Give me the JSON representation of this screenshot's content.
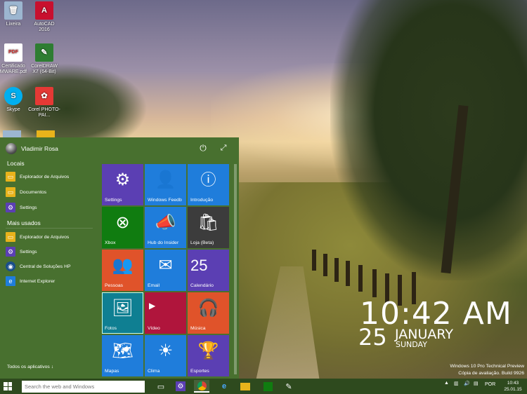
{
  "desktop": {
    "icons": [
      {
        "label": "Lixeira",
        "icon": "recycle-bin-icon",
        "color": "#9cb6d0"
      },
      {
        "label": "AutoCAD 2016",
        "icon": "autocad-icon",
        "color": "#c8102e"
      },
      {
        "label": "Certificado MWARE.pdf",
        "icon": "pdf-icon",
        "color": "#d32f2f"
      },
      {
        "label": "CorelDRAW X7 (64-Bit)",
        "icon": "coreldraw-icon",
        "color": "#2e7d32"
      },
      {
        "label": "Skype",
        "icon": "skype-icon",
        "color": "#00aff0"
      },
      {
        "label": "Corel PHOTO-PAI...",
        "icon": "corel-photopaint-icon",
        "color": "#e53935"
      }
    ]
  },
  "start_menu": {
    "user_name": "Vladimir Rosa",
    "sections": {
      "locais_title": "Locais",
      "mais_usados_title": "Mais usados"
    },
    "locais": [
      {
        "label": "Explorador de Arquivos",
        "icon": "file-explorer-icon"
      },
      {
        "label": "Documentos",
        "icon": "documents-icon"
      },
      {
        "label": "Settings",
        "icon": "settings-icon"
      }
    ],
    "mais_usados": [
      {
        "label": "Explorador de Arquivos",
        "icon": "file-explorer-icon"
      },
      {
        "label": "Settings",
        "icon": "settings-icon"
      },
      {
        "label": "Central de Soluções HP",
        "icon": "hp-icon"
      },
      {
        "label": "Internet Explorer",
        "icon": "internet-explorer-icon"
      }
    ],
    "all_apps_label": "Todos os aplicativos ↓",
    "tiles": [
      {
        "label": "Settings",
        "icon": "gear-icon",
        "color": "#5b3fb3"
      },
      {
        "label": "Windows Feedb",
        "icon": "feedback-icon",
        "color": "#1f7ddb"
      },
      {
        "label": "Introdução",
        "icon": "help-icon",
        "color": "#1f7ddb"
      },
      {
        "label": "Xbox",
        "icon": "xbox-icon",
        "color": "#107c10"
      },
      {
        "label": "Hub do Insider",
        "icon": "megaphone-icon",
        "color": "#1f7ddb"
      },
      {
        "label": "Loja (Beta)",
        "icon": "store-icon",
        "color": "#3c3c3c"
      },
      {
        "label": "Pessoas",
        "icon": "people-icon",
        "color": "#e0532a"
      },
      {
        "label": "Email",
        "icon": "mail-icon",
        "color": "#1f7ddb"
      },
      {
        "label": "Calendário",
        "icon": "calendar-icon",
        "color": "#5b3fb3",
        "number": "25"
      },
      {
        "label": "Fotos",
        "icon": "photos-icon",
        "color": "#0f7f92"
      },
      {
        "label": "Vídeo",
        "icon": "video-icon",
        "color": "#b0153c"
      },
      {
        "label": "Música",
        "icon": "music-icon",
        "color": "#e0532a"
      },
      {
        "label": "Mapas",
        "icon": "maps-icon",
        "color": "#1f7ddb"
      },
      {
        "label": "Clima",
        "icon": "weather-icon",
        "color": "#1f7ddb"
      },
      {
        "label": "Esportes",
        "icon": "trophy-icon",
        "color": "#5b3fb3"
      }
    ],
    "colors": {
      "menu_bg": "#48702f",
      "taskbar_bg": "#2e4a1e"
    }
  },
  "clock_overlay": {
    "time": "10:42 AM",
    "day": "25",
    "month": "JANUARY",
    "weekday": "SUNDAY"
  },
  "watermark": {
    "line1": "Windows 10 Pro Technical Preview",
    "line2": "Cópia de avaliação. Build 9926"
  },
  "taskbar": {
    "search_placeholder": "Search the web and Windows",
    "apps": [
      {
        "name": "task-view-icon"
      },
      {
        "name": "settings-icon"
      },
      {
        "name": "chrome-icon"
      },
      {
        "name": "internet-explorer-icon"
      },
      {
        "name": "file-explorer-icon"
      },
      {
        "name": "store-icon"
      },
      {
        "name": "network-app-icon"
      }
    ],
    "language": "POR",
    "time": "10:43",
    "date": "25.01.15"
  }
}
